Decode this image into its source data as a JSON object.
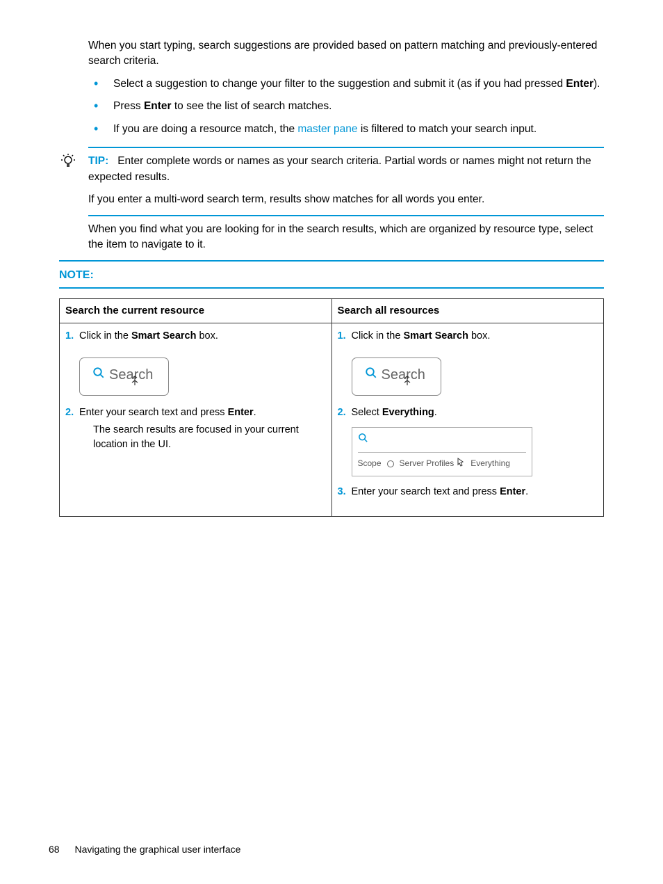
{
  "intro": {
    "para1a": "When you start typing, search suggestions are provided based on pattern matching and previously-entered search criteria.",
    "bullets": [
      {
        "pre": "Select a suggestion to change your filter to the suggestion and submit it (as if you had pressed ",
        "bold": "Enter",
        "post": ")."
      },
      {
        "pre": "Press ",
        "bold": "Enter",
        "post": " to see the list of search matches."
      },
      {
        "pre": "If you are doing a resource match, the ",
        "link": "master pane",
        "post": " is filtered to match your search input."
      }
    ]
  },
  "tip": {
    "label": "TIP:",
    "line1": "Enter complete words or names as your search criteria. Partial words or names might not return the expected results.",
    "line2": "If you enter a multi-word search term, results show matches for all words you enter."
  },
  "after": "When you find what you are looking for in the search results, which are organized by resource type, select the item to navigate to it.",
  "note_label": "NOTE:",
  "table": {
    "headers": [
      "Search the current resource",
      "Search all resources"
    ],
    "left": {
      "s1n": "1.",
      "s1a": "Click in the ",
      "s1b": "Smart Search",
      "s1c": " box.",
      "img_label": "Search",
      "s2n": "2.",
      "s2a": "Enter your search text and press ",
      "s2b": "Enter",
      "s2c": ".",
      "s2_sub": "The search results are focused in your current location in the UI."
    },
    "right": {
      "s1n": "1.",
      "s1a": "Click in the ",
      "s1b": "Smart Search",
      "s1c": " box.",
      "img_label": "Search",
      "s2n": "2.",
      "s2a": "Select ",
      "s2b": "Everything",
      "s2c": ".",
      "scope": {
        "label": "Scope",
        "opt1": "Server Profiles",
        "opt2": "Everything"
      },
      "s3n": "3.",
      "s3a": "Enter your search text and press ",
      "s3b": "Enter",
      "s3c": "."
    }
  },
  "footer": {
    "page": "68",
    "title": "Navigating the graphical user interface"
  }
}
